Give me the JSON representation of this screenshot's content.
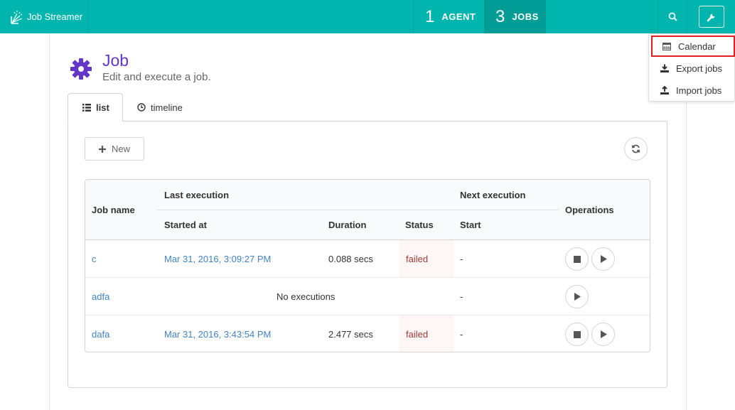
{
  "brand": {
    "name": "Job Streamer"
  },
  "nav": {
    "agent": {
      "count": "1",
      "label": "AGENT"
    },
    "jobs": {
      "count": "3",
      "label": "JOBS"
    }
  },
  "menu": {
    "items": [
      {
        "label": "Calendar",
        "icon": "calendar-icon"
      },
      {
        "label": "Export jobs",
        "icon": "download-icon"
      },
      {
        "label": "Import jobs",
        "icon": "upload-icon"
      }
    ]
  },
  "page": {
    "title": "Job",
    "subtitle": "Edit and execute a job.",
    "icon": "gear-icon",
    "accent": "#6435c9"
  },
  "tabs": [
    {
      "label": "list",
      "icon": "list-icon"
    },
    {
      "label": "timeline",
      "icon": "clock-icon"
    }
  ],
  "toolbar": {
    "new_label": "New"
  },
  "table": {
    "headers": {
      "job_name": "Job name",
      "last_execution": "Last execution",
      "next_execution": "Next execution",
      "operations": "Operations",
      "started_at": "Started at",
      "duration": "Duration",
      "status": "Status",
      "start": "Start"
    },
    "rows": [
      {
        "name": "c",
        "started_at": "Mar 31, 2016, 3:09:27 PM",
        "duration": "0.088 secs",
        "status": "failed",
        "next_start": "-",
        "no_exec": ""
      },
      {
        "name": "adfa",
        "started_at": "",
        "duration": "",
        "status": "",
        "next_start": "-",
        "no_exec": "No executions"
      },
      {
        "name": "dafa",
        "started_at": "Mar 31, 2016, 3:43:54 PM",
        "duration": "2.477 secs",
        "status": "failed",
        "next_start": "-",
        "no_exec": ""
      }
    ]
  },
  "colors": {
    "topbar": "#00b5ad",
    "active_nav": "#009c95",
    "link": "#4183c4",
    "failed": "#9f3a38"
  }
}
